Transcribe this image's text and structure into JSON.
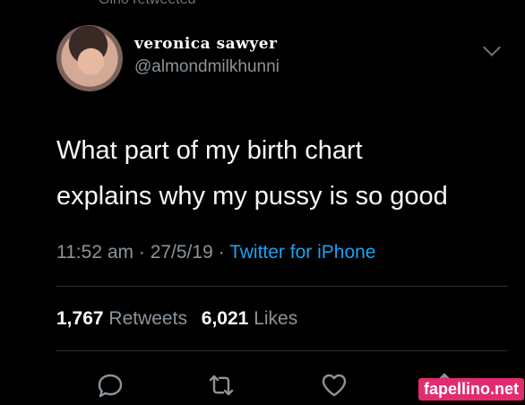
{
  "header": {
    "retweeted_label": "Gino retweeted"
  },
  "tweet": {
    "display_name": "veronica sawyer",
    "handle": "@almondmilkhunni",
    "text_line_1": "What part of my birth chart",
    "text_line_2": "explains why my pussy is so good",
    "time": "11:52 am",
    "date": "27/5/19",
    "separator": "·",
    "source": "Twitter for iPhone",
    "retweets_count": "1,767",
    "retweets_label": "Retweets",
    "likes_count": "6,021",
    "likes_label": "Likes"
  },
  "icons": [
    "reply-icon",
    "retweet-icon",
    "like-icon",
    "share-icon"
  ],
  "watermark": "fapellino.net",
  "colors": {
    "background": "#000000",
    "accent": "#1da1f2",
    "muted": "#8b949b"
  }
}
